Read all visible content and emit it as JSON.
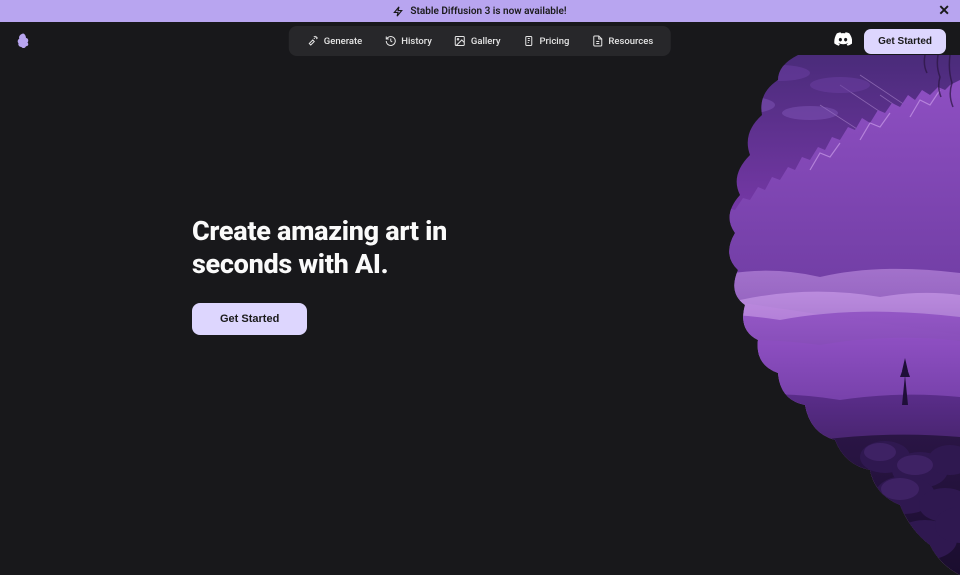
{
  "banner": {
    "text": "Stable Diffusion 3 is now available!"
  },
  "nav": {
    "items": [
      {
        "label": "Generate"
      },
      {
        "label": "History"
      },
      {
        "label": "Gallery"
      },
      {
        "label": "Pricing"
      },
      {
        "label": "Resources"
      }
    ]
  },
  "header": {
    "cta": "Get Started"
  },
  "hero": {
    "title_line1": "Create amazing art in",
    "title_line2": "seconds with AI.",
    "cta": "Get Started"
  },
  "colors": {
    "banner_bg": "#b8a5f0",
    "btn_bg": "#ddd6fe",
    "pill_bg": "#27272a",
    "page_bg": "#18181b"
  }
}
